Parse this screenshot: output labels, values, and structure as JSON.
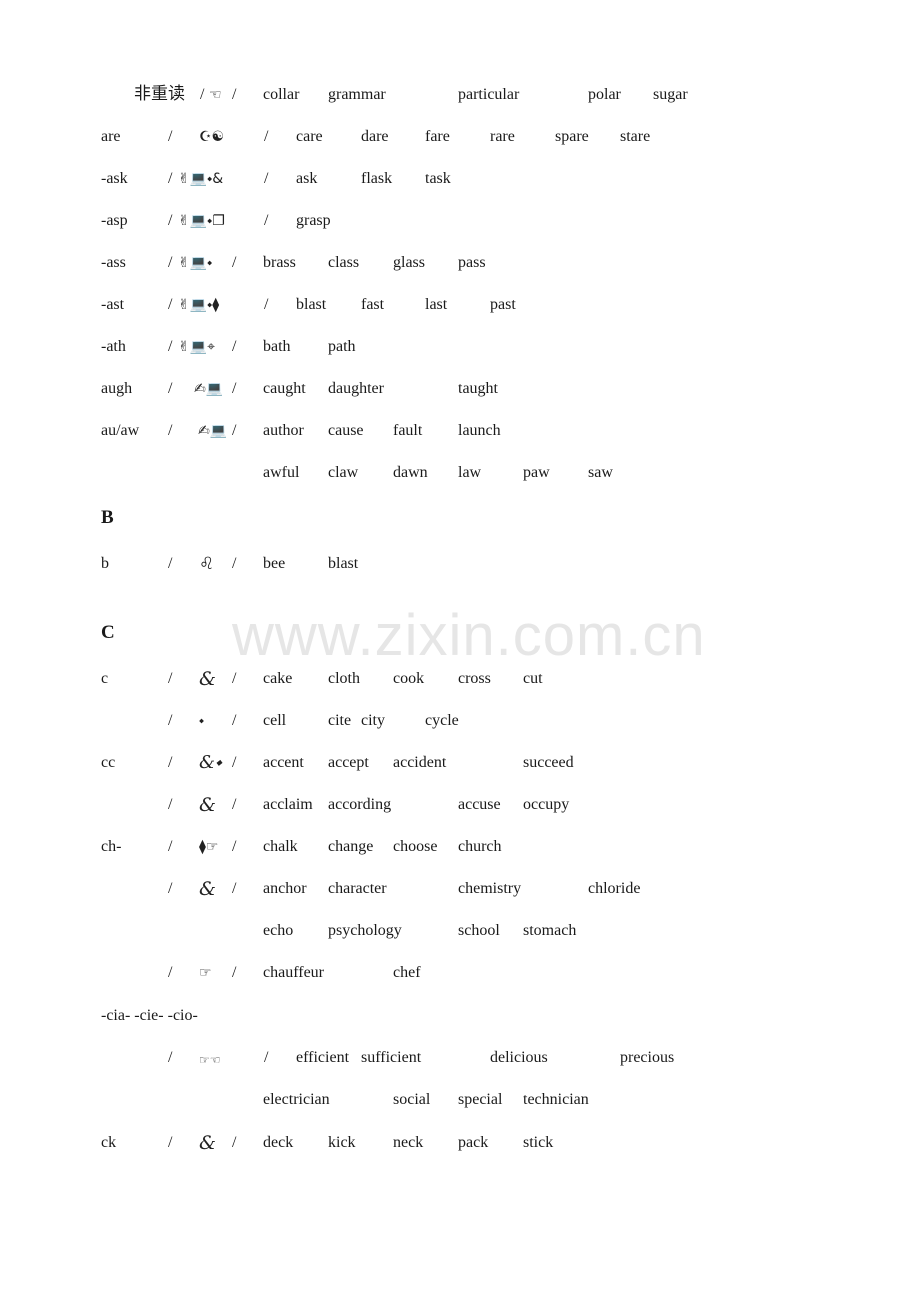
{
  "watermark": "www.zixin.com.cn",
  "headings": {
    "B": "B",
    "C": "C"
  },
  "rows": [
    {
      "label": "非重读",
      "slash1": "/",
      "symbol": "☜",
      "slash2": "/",
      "words": [
        "collar",
        "grammar",
        "particular",
        "polar",
        "sugar"
      ]
    },
    {
      "label": "are",
      "slash1": "/",
      "symbol": "☪☯",
      "slash2": "/",
      "words": [
        "care",
        "dare",
        "fare",
        "rare",
        "spare",
        "stare"
      ]
    },
    {
      "label": "-ask",
      "slash1": "/",
      "symbol": "✌💻⬩&",
      "slash2": "/",
      "words": [
        "ask",
        "flask",
        "task"
      ]
    },
    {
      "label": "-asp",
      "slash1": "/",
      "symbol": "✌💻⬩❐",
      "slash2": "/",
      "words": [
        "grasp"
      ]
    },
    {
      "label": "-ass",
      "slash1": "/",
      "symbol": "✌💻⬩",
      "slash2": "/",
      "words": [
        "brass",
        "class",
        "glass",
        "pass"
      ]
    },
    {
      "label": "-ast",
      "slash1": "/",
      "symbol": "✌💻⬩⧫",
      "slash2": "/",
      "words": [
        "blast",
        "fast",
        "last",
        "past"
      ]
    },
    {
      "label": "-ath",
      "slash1": "/",
      "symbol": "✌💻⌖",
      "slash2": "/",
      "words": [
        "bath",
        "path"
      ]
    },
    {
      "label": "augh",
      "slash1": "/",
      "symbol": "✍💻",
      "slash2": "/",
      "words": [
        "caught",
        "daughter",
        "taught"
      ]
    },
    {
      "label": "au/aw",
      "slash1": "/",
      "symbol": "✍💻",
      "slash2": "/",
      "words": [
        "author",
        "cause",
        "fault",
        "launch"
      ]
    },
    {
      "label": "",
      "slash1": "",
      "symbol": "",
      "slash2": "",
      "words": [
        "awful",
        "claw",
        "dawn",
        "law",
        "paw",
        "saw"
      ]
    },
    {
      "label": "b",
      "slash1": "/",
      "symbol": "♌",
      "slash2": "/",
      "words": [
        "bee",
        "blast"
      ]
    },
    {
      "label": "c",
      "slash1": "/",
      "symbol": "&",
      "slash2": "/",
      "words": [
        "cake",
        "cloth",
        "cook",
        "cross",
        "cut"
      ]
    },
    {
      "label": "",
      "slash1": "/",
      "symbol": "⬩",
      "slash2": "/",
      "words": [
        "cell",
        "cite",
        "city",
        "cycle"
      ]
    },
    {
      "label": "cc",
      "slash1": "/",
      "symbol": "&⬩",
      "slash2": "/",
      "words": [
        "accent",
        "accept",
        "accident",
        "succeed"
      ]
    },
    {
      "label": "",
      "slash1": "/",
      "symbol": "&",
      "slash2": "/",
      "words": [
        "acclaim",
        "according",
        "accuse",
        "occupy"
      ]
    },
    {
      "label": "ch-",
      "slash1": "/",
      "symbol": "⧫☞",
      "slash2": "/",
      "words": [
        "chalk",
        "change",
        "choose",
        "church"
      ]
    },
    {
      "label": "",
      "slash1": "/",
      "symbol": "&",
      "slash2": "/",
      "words": [
        "anchor",
        "character",
        "chemistry",
        "chloride"
      ]
    },
    {
      "label": "",
      "slash1": "",
      "symbol": "",
      "slash2": "",
      "words": [
        "echo",
        "psychology",
        "school",
        "stomach"
      ]
    },
    {
      "label": "",
      "slash1": "/",
      "symbol": "☞",
      "slash2": "/",
      "words": [
        "chauffeur",
        "chef"
      ]
    },
    {
      "label": "-cia- -cie- -cio-",
      "slash1": "",
      "symbol": "",
      "slash2": "",
      "words": []
    },
    {
      "label": "",
      "slash1": "/",
      "symbol": "☞☜",
      "slash2": "/",
      "words": [
        "efficient",
        "sufficient",
        "delicious",
        "precious"
      ]
    },
    {
      "label": "",
      "slash1": "",
      "symbol": "",
      "slash2": "",
      "words": [
        "electrician",
        "social",
        "special",
        "technician"
      ]
    },
    {
      "label": "ck",
      "slash1": "/",
      "symbol": "&",
      "slash2": "/",
      "words": [
        "deck",
        "kick",
        "neck",
        "pack",
        "stick"
      ]
    }
  ]
}
